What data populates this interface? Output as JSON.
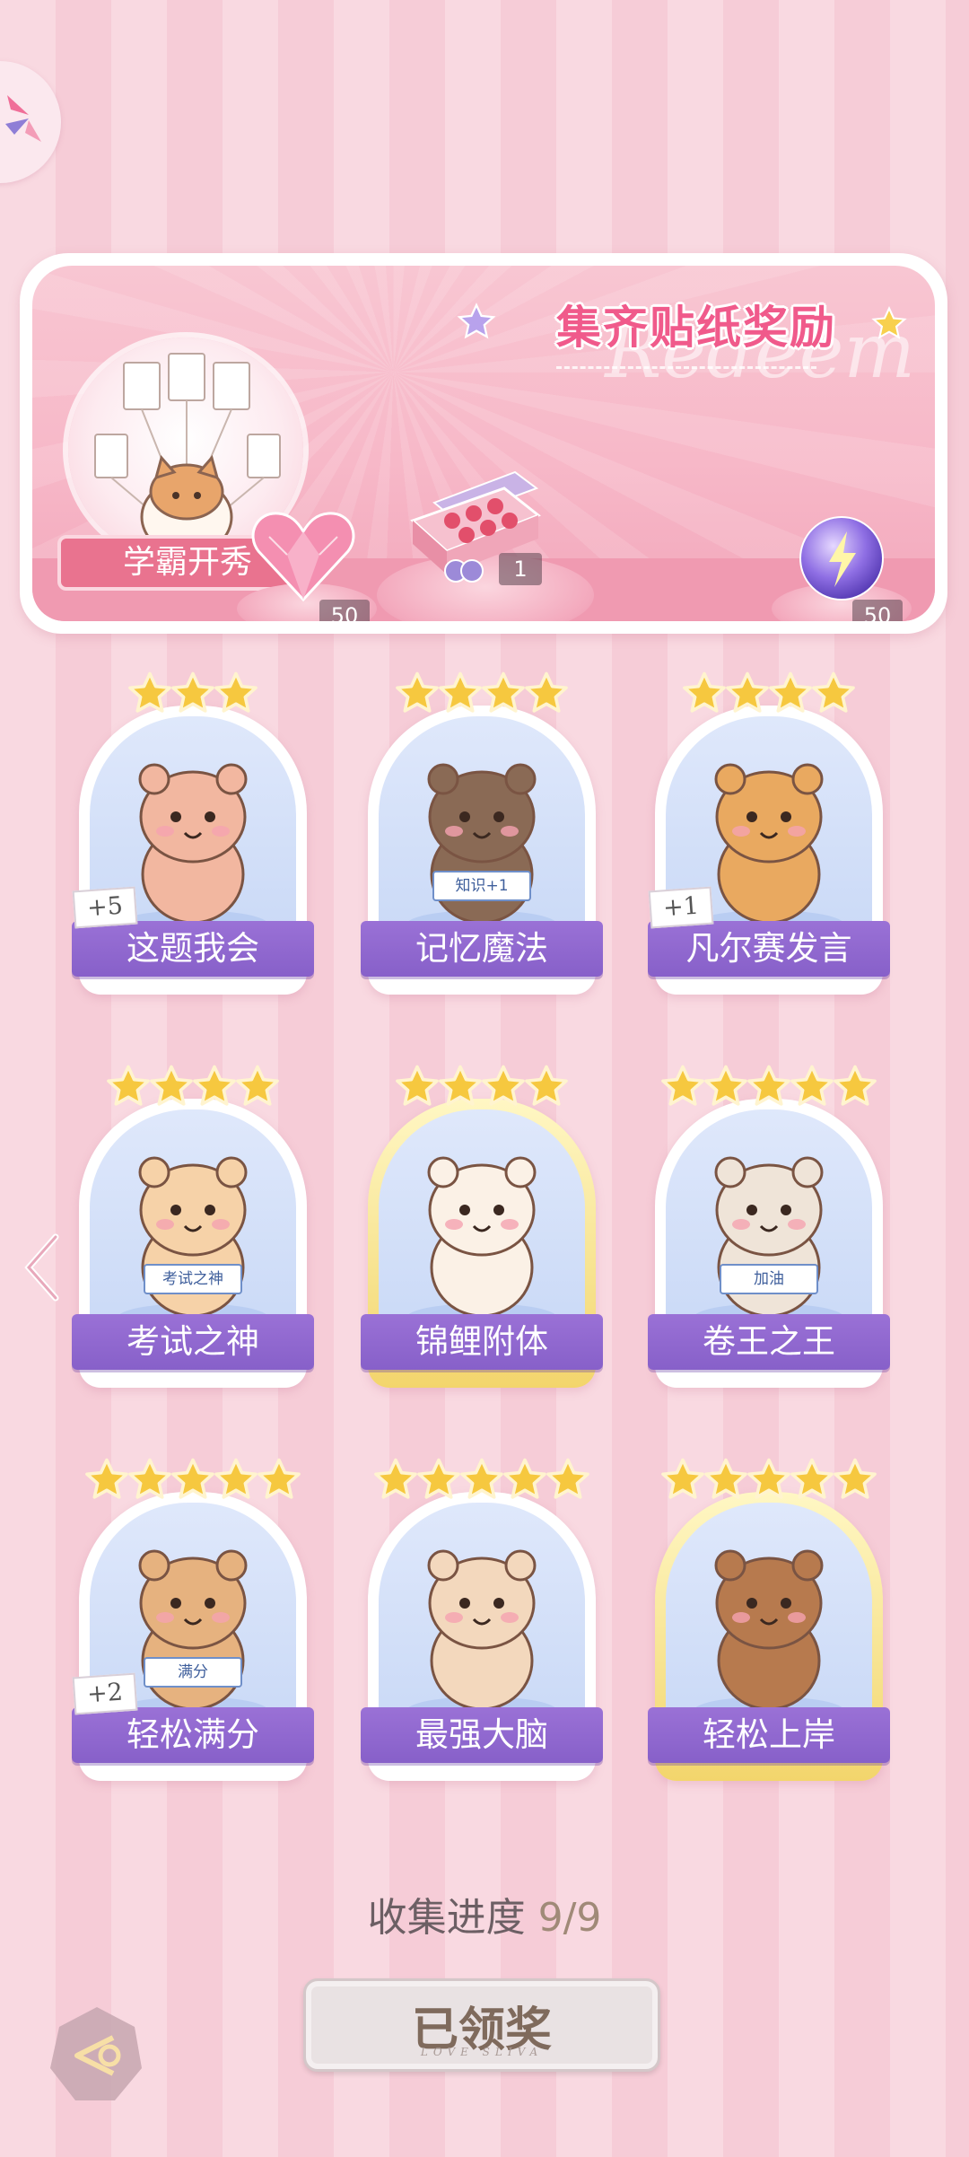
{
  "header": {
    "menu_icon": "pinwheel-icon"
  },
  "banner": {
    "title": "集齐贴纸奖励",
    "watermark": "Redeem",
    "album_label": "学霸开秀",
    "rewards": [
      {
        "icon": "pink-diamond-heart-icon",
        "count": "50"
      },
      {
        "icon": "gift-box-icon",
        "count": "1"
      },
      {
        "icon": "lightning-orb-icon",
        "count": "50"
      }
    ]
  },
  "cards": [
    {
      "label": "这题我会",
      "stars": 3,
      "extra": "+5",
      "gold": false,
      "art": "bear-at-desk"
    },
    {
      "label": "记忆魔法",
      "stars": 4,
      "extra": "",
      "gold": false,
      "art": "otter-wizard",
      "art_text": "知识+1"
    },
    {
      "label": "凡尔赛发言",
      "stars": 4,
      "extra": "+1",
      "gold": false,
      "art": "lion-microphone"
    },
    {
      "label": "考试之神",
      "stars": 4,
      "extra": "",
      "gold": false,
      "art": "angel-cat",
      "art_text": "考试之神"
    },
    {
      "label": "锦鲤附体",
      "stars": 4,
      "extra": "",
      "gold": true,
      "art": "bear-koi"
    },
    {
      "label": "卷王之王",
      "stars": 5,
      "extra": "",
      "gold": false,
      "art": "cat-studying",
      "art_text": "加油"
    },
    {
      "label": "轻松满分",
      "stars": 5,
      "extra": "+2",
      "gold": false,
      "art": "puppy-full-score",
      "art_text": "满分"
    },
    {
      "label": "最强大脑",
      "stars": 5,
      "extra": "",
      "gold": false,
      "art": "cat-with-papers"
    },
    {
      "label": "轻松上岸",
      "stars": 5,
      "extra": "",
      "gold": true,
      "art": "squirrel-graduate"
    }
  ],
  "progress": {
    "label": "收集进度",
    "value": "9/9"
  },
  "claim": {
    "label": "已领奖",
    "sub": "LOVE SLIVA"
  },
  "colors": {
    "label_purple": "#8f67cf",
    "banner_pink": "#f7b8c8",
    "title_pink": "#f05a8b"
  }
}
